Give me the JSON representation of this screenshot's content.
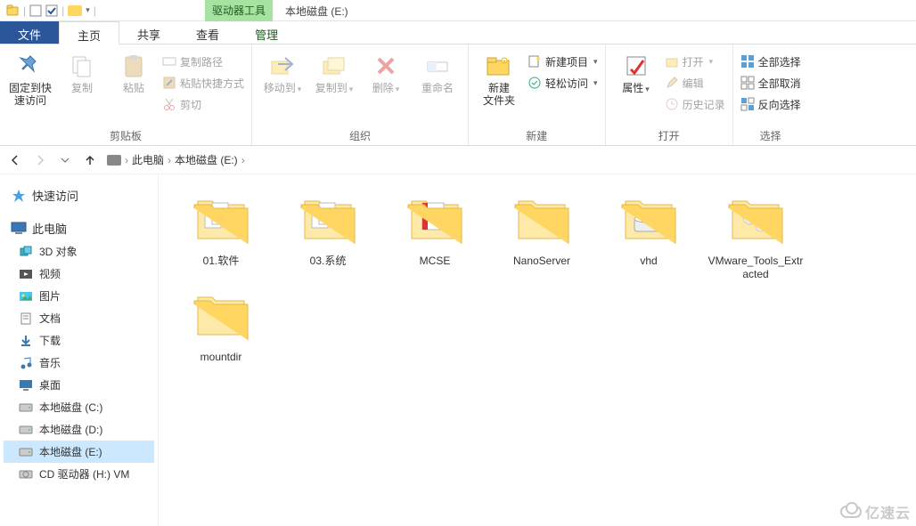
{
  "window": {
    "drive_tools_label": "驱动器工具",
    "title": "本地磁盘 (E:)"
  },
  "tabs": {
    "file": "文件",
    "home": "主页",
    "share": "共享",
    "view": "查看",
    "manage": "管理"
  },
  "ribbon": {
    "clipboard": {
      "pin": "固定到快\n速访问",
      "copy": "复制",
      "paste": "粘贴",
      "copy_path": "复制路径",
      "paste_shortcut": "粘贴快捷方式",
      "cut": "剪切",
      "group": "剪贴板"
    },
    "organize": {
      "move_to": "移动到",
      "copy_to": "复制到",
      "delete": "删除",
      "rename": "重命名",
      "group": "组织"
    },
    "new": {
      "new_folder": "新建\n文件夹",
      "new_item": "新建项目",
      "easy_access": "轻松访问",
      "group": "新建"
    },
    "open": {
      "properties": "属性",
      "open": "打开",
      "edit": "编辑",
      "history": "历史记录",
      "group": "打开"
    },
    "select": {
      "select_all": "全部选择",
      "select_none": "全部取消",
      "invert": "反向选择",
      "group": "选择"
    }
  },
  "breadcrumb": {
    "root": "此电脑",
    "drive": "本地磁盘 (E:)"
  },
  "sidebar": {
    "quick_access": "快速访问",
    "this_pc": "此电脑",
    "items": [
      {
        "label": "3D 对象",
        "key": "3d"
      },
      {
        "label": "视频",
        "key": "video"
      },
      {
        "label": "图片",
        "key": "pictures"
      },
      {
        "label": "文档",
        "key": "documents"
      },
      {
        "label": "下载",
        "key": "downloads"
      },
      {
        "label": "音乐",
        "key": "music"
      },
      {
        "label": "桌面",
        "key": "desktop"
      },
      {
        "label": "本地磁盘 (C:)",
        "key": "drive-c"
      },
      {
        "label": "本地磁盘 (D:)",
        "key": "drive-d"
      },
      {
        "label": "本地磁盘 (E:)",
        "key": "drive-e",
        "selected": true
      },
      {
        "label": "CD 驱动器 (H:) VM",
        "key": "drive-h"
      }
    ]
  },
  "items": [
    {
      "name": "01.软件",
      "type": "folder-docs"
    },
    {
      "name": "03.系统",
      "type": "folder-docs"
    },
    {
      "name": "MCSE",
      "type": "folder-pdf"
    },
    {
      "name": "NanoServer",
      "type": "folder"
    },
    {
      "name": "vhd",
      "type": "folder-drive"
    },
    {
      "name": "VMware_Tools_Extracted",
      "type": "folder-gears"
    },
    {
      "name": "mountdir",
      "type": "folder"
    }
  ],
  "watermark": "亿速云"
}
